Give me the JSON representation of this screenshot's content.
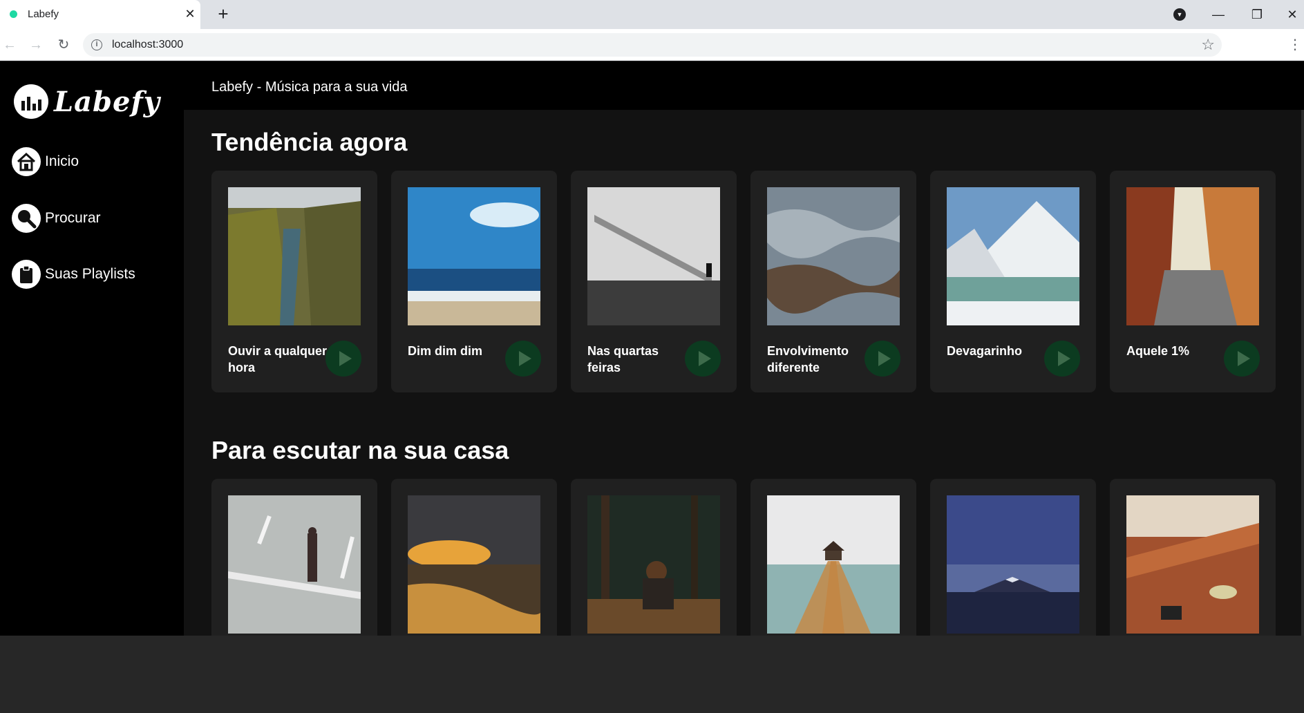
{
  "browser": {
    "tab_title": "Labefy",
    "url": "localhost:3000",
    "tab_close": "✕",
    "new_tab": "+",
    "back_icon": "←",
    "forward_icon": "→",
    "reload_icon": "↻",
    "info_icon": "i",
    "star_icon": "☆",
    "minimize_icon": "—",
    "restore_icon": "❐",
    "close_icon": "✕",
    "profile_icon": "▼",
    "menu_icon": "⋮",
    "accent_dot_color": "#1ed9a3"
  },
  "sidebar": {
    "logo_text": "Labefy",
    "items": [
      {
        "label": "Inicio",
        "icon": "home-icon"
      },
      {
        "label": "Procurar",
        "icon": "search-icon"
      },
      {
        "label": "Suas Playlists",
        "icon": "clipboard-icon"
      }
    ]
  },
  "header": {
    "title": "Labefy - Música para a sua vida"
  },
  "sections": [
    {
      "title": "Tendência agora",
      "cards": [
        {
          "title": "Ouvir a qualquer hora",
          "cover": "canyon-moss"
        },
        {
          "title": "Dim dim dim",
          "cover": "ocean-beach"
        },
        {
          "title": "Nas quartas feiras",
          "cover": "stone-steps-bw"
        },
        {
          "title": "Envolvimento diferente",
          "cover": "water-ripples"
        },
        {
          "title": "Devagarinho",
          "cover": "snowy-mountain-lake"
        },
        {
          "title": "Aquele 1%",
          "cover": "narrow-alley"
        }
      ]
    },
    {
      "title": "Para escutar na sua casa",
      "cards": [
        {
          "title": "",
          "cover": "man-walking-road"
        },
        {
          "title": "",
          "cover": "sunset-beach"
        },
        {
          "title": "",
          "cover": "forest-reading"
        },
        {
          "title": "",
          "cover": "pier-gazebo"
        },
        {
          "title": "",
          "cover": "night-mountain"
        },
        {
          "title": "",
          "cover": "cafe-table"
        }
      ]
    }
  ],
  "colors": {
    "sidebar_bg": "#000000",
    "main_bg": "#121212",
    "card_bg": "#202020",
    "play_bg": "#0c3b20",
    "player_bar": "#272727"
  }
}
